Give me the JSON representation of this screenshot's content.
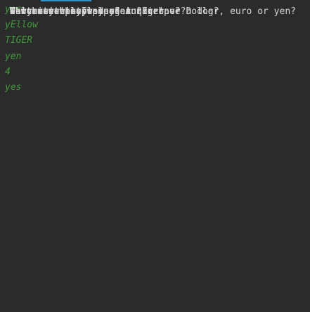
{
  "console": {
    "lines": [
      {
        "text": "Welcome to my computer quiz!",
        "kind": "output"
      },
      {
        "text": "Do you want to play?",
        "kind": "output"
      },
      {
        "text": "yes",
        "kind": "input"
      },
      {
        "text": "Ok! Let's play :)",
        "kind": "output"
      },
      {
        "text": "What is the color of sun?",
        "kind": "output"
      },
      {
        "text": "yEllow",
        "kind": "input"
      },
      {
        "text": "Correct!",
        "kind": "output"
      },
      {
        "text": "Which one is faster? A tiger or a dog?",
        "kind": "output"
      },
      {
        "text": "TIGER",
        "kind": "input"
      },
      {
        "text": "Correct!",
        "kind": "output"
      },
      {
        "text": "What currency we use in Europe? Dollar, euro or yen?",
        "kind": "output"
      },
      {
        "text": "yen",
        "kind": "input"
      },
      {
        "text": "Incorrect!",
        "kind": "output"
      },
      {
        "text": "How many wheels does a car have?",
        "kind": "output"
      },
      {
        "text": "4",
        "kind": "input"
      },
      {
        "text": "Correct!",
        "kind": "output"
      },
      {
        "text": "Do you wanna play again?",
        "kind": "output"
      },
      {
        "text": "yes",
        "kind": "input"
      },
      {
        "text": "Ok! Let's play :)",
        "kind": "output"
      },
      {
        "text": "What is the color of sun?",
        "kind": "output"
      }
    ]
  },
  "colors": {
    "background": "#2b2b2b",
    "output_text": "#d4d4d4",
    "input_text": "#3f9a3a",
    "accent": "#3592c4"
  }
}
